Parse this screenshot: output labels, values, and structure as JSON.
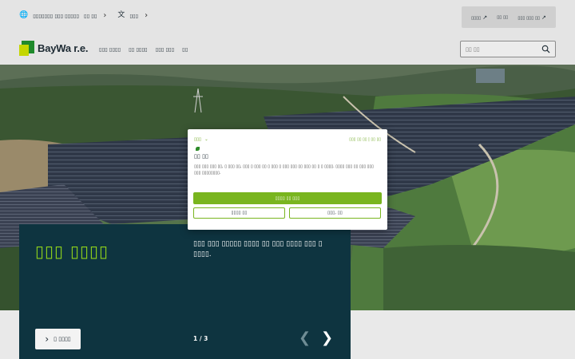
{
  "topbar": {
    "region_label": "▯▯▯▯▯▯▯ ▯▯▯ ▯▯▯▯▯",
    "country_label": "▯▯ ▯▯",
    "language_label": "▯▯▯",
    "links": [
      {
        "label": "▯▯▯▯"
      },
      {
        "label": "▯▯ ▯▯"
      },
      {
        "label": "▯▯▯ ▯▯▯ ▯▯"
      }
    ]
  },
  "header": {
    "logo_text": "BayWa r.e.",
    "nav": [
      "▯▯▯ ▯▯▯▯",
      "▯▯ ▯▯▯▯",
      "▯▯▯ ▯▯▯",
      "▯▯"
    ],
    "search_placeholder": "▯▯ ▯▯"
  },
  "hero": {
    "title": "▯▯▯ ▯▯▯▯",
    "description": "▯▯▯ ▯▯▯ ▯▯▯▯▯ ▯▯▯▯ ▯▯ ▯▯▯ ▯▯▯▯ ▯▯▯ ▯ ▯▯▯▯.",
    "more_button": "▯ ▯▯▯▯",
    "counter": "1 / 3"
  },
  "cookie": {
    "language": "▯▯▯",
    "links": "▯▯▯ ▯▯ ▯▯ | ▯▯ ▯▯",
    "title": "▯▯ ▯▯",
    "text": "▯▯▯ ▯▯▯ ▯▯▯ ▯▯, ▯ ▯▯▯ ▯▯, ▯▯▯ ▯ ▯▯▯ ▯▯ ▯ ▯▯▯ ▯ ▯▯▯ ▯▯▯ ▯▯ ▯▯▯ ▯▯ ▯ ▯ ▯▯▯▯. ▯▯▯▯ ▯▯▯ ▯▯ ▯▯▯ ▯▯▯ ▯▯▯ ▯▯▯▯▯▯▯▯.",
    "accept_label": "▯▯▯▯ ▯▯ ▯▯▯",
    "settings_label": "▯▯▯▯ ▯▯",
    "reject_label": "▯▯▯, ▯▯"
  },
  "colors": {
    "accent_green": "#79b51f",
    "panel_bg": "#0e3440",
    "title_green": "#8fd11b"
  }
}
